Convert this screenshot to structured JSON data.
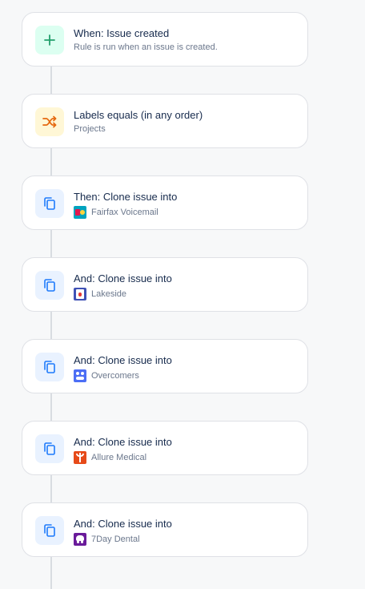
{
  "colors": {
    "trigger_bg": "#dcfff1",
    "trigger_fg": "#22a06b",
    "condition_bg": "#fff7d6",
    "condition_fg": "#e56910",
    "action_bg": "#e9f2ff",
    "action_fg": "#1d7afc"
  },
  "steps": [
    {
      "icon": "plus-icon",
      "title": "When: Issue created",
      "subtitle": "Rule is run when an issue is created."
    },
    {
      "icon": "shuffle-icon",
      "title": "Labels equals (in any order)",
      "subtitle": "Projects"
    },
    {
      "icon": "copy-icon",
      "title": "Then: Clone issue into",
      "project_icon": "fairfax-voicemail-logo",
      "subtitle": "Fairfax Voicemail"
    },
    {
      "icon": "copy-icon",
      "title": "And: Clone issue into",
      "project_icon": "lakeside-logo",
      "subtitle": "Lakeside"
    },
    {
      "icon": "copy-icon",
      "title": "And: Clone issue into",
      "project_icon": "overcomers-logo",
      "subtitle": "Overcomers"
    },
    {
      "icon": "copy-icon",
      "title": "And: Clone issue into",
      "project_icon": "allure-medical-logo",
      "subtitle": "Allure Medical"
    },
    {
      "icon": "copy-icon",
      "title": "And: Clone issue into",
      "project_icon": "7day-dental-logo",
      "subtitle": "7Day Dental"
    }
  ]
}
